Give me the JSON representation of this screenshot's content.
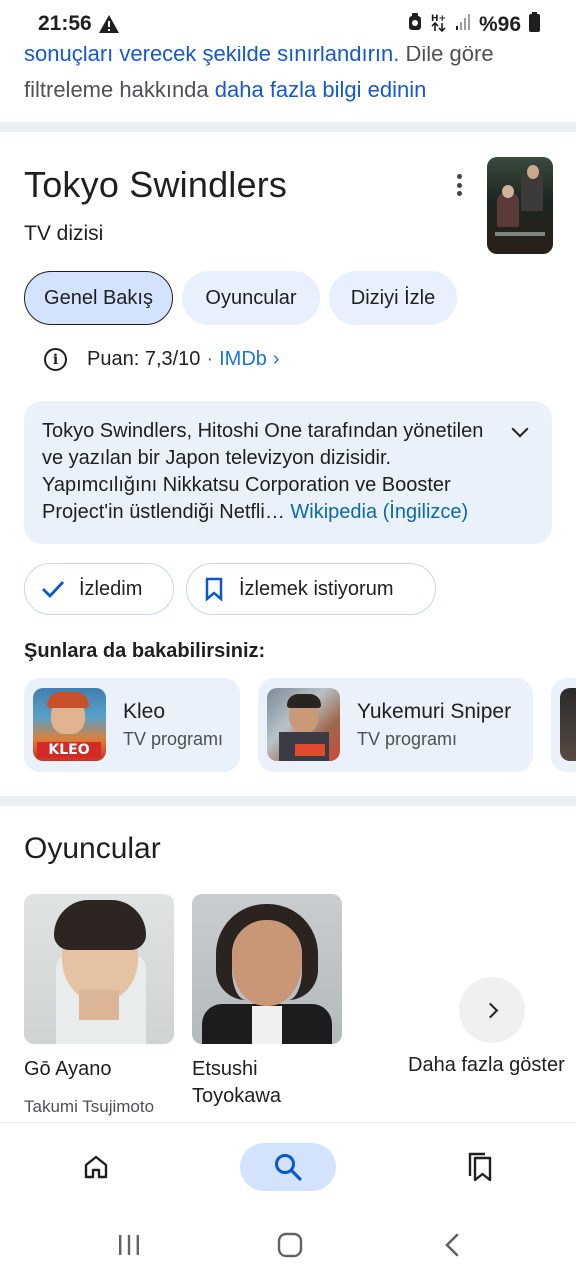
{
  "status_bar": {
    "time": "21:56",
    "battery": "%96",
    "icons": [
      "warning-icon",
      "data-saver-icon",
      "network-arrows-icon",
      "signal-icon",
      "battery-icon"
    ]
  },
  "top_snippet": {
    "link_part1": "sonuçları verecek şekilde sınırlandırın.",
    "text_part": " Dile göre filtreleme hakkında ",
    "link_part2": "daha fazla bilgi edinin"
  },
  "entity": {
    "title": "Tokyo Swindlers",
    "subtitle": "TV dizisi"
  },
  "tabs": [
    {
      "label": "Genel Bakış",
      "active": true
    },
    {
      "label": "Oyuncular",
      "active": false
    },
    {
      "label": "Diziyi İzle",
      "active": false
    }
  ],
  "rating": {
    "label": "Puan: 7,3/10",
    "separator": "·",
    "source": "IMDb",
    "arrow": "›"
  },
  "description": {
    "text": "Tokyo Swindlers, Hitoshi One tarafından yönetilen ve yazılan bir Japon televizyon dizisidir. Yapımcılığını Nikkatsu Corporation ve Booster Project'in üstlendiği Netfli…",
    "source_link": "Wikipedia (İngilizce)"
  },
  "actions": {
    "watched": "İzledim",
    "want_to_watch": "İzlemek istiyorum"
  },
  "related": {
    "heading": "Şunlara da bakabilirsiniz:",
    "items": [
      {
        "title": "Kleo",
        "type": "TV programı"
      },
      {
        "title": "Yukemuri Sniper",
        "type": "TV programı"
      }
    ]
  },
  "cast": {
    "heading": "Oyuncular",
    "members": [
      {
        "name": "Gō Ayano",
        "role": "Takumi Tsujimoto"
      },
      {
        "name": "Etsushi Toyokawa",
        "role": ""
      }
    ],
    "more_label": "Daha fazla göster"
  },
  "bottom_nav": [
    "home-icon",
    "search-icon",
    "saved-icon"
  ],
  "colors": {
    "link": "#1558d6",
    "chip_bg": "#e8f0fe",
    "chip_active_bg": "#d3e3fd",
    "card_bg": "#eaf1fb",
    "divider": "#eceff1"
  }
}
